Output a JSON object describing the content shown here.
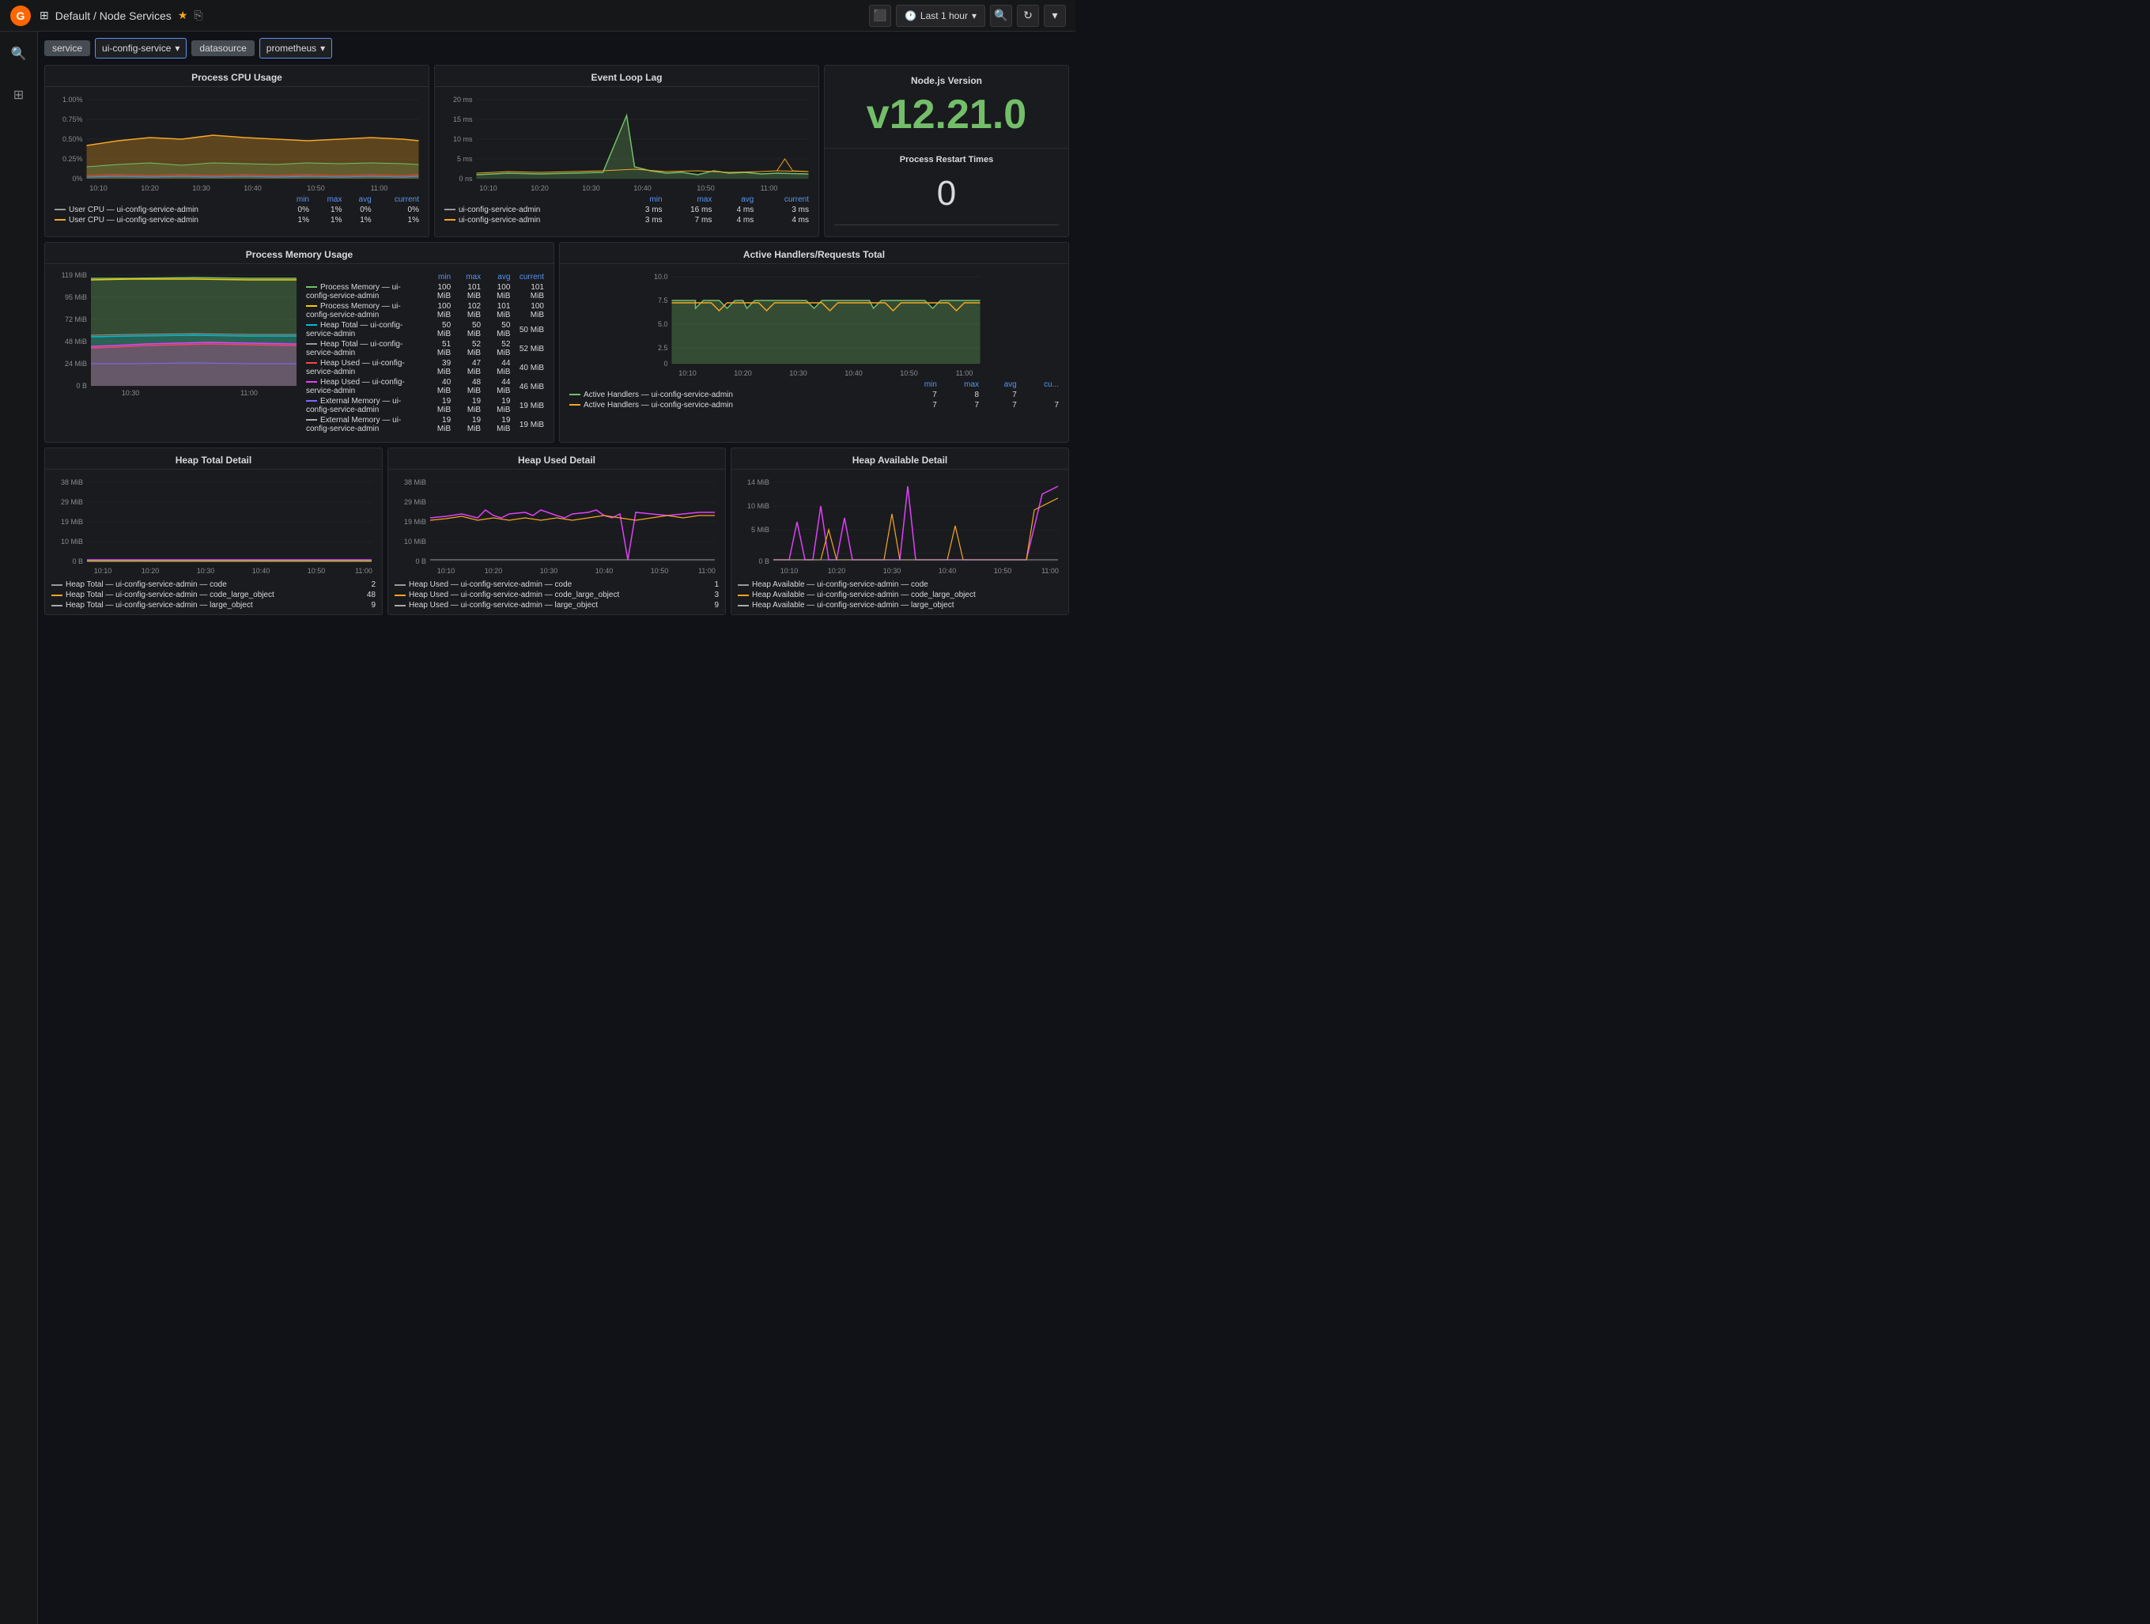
{
  "topbar": {
    "title": "Default / Node Services",
    "star_icon": "★",
    "share_icon": "⎘",
    "time_range": "Last 1 hour",
    "grid_icon": "⊞"
  },
  "filters": {
    "service_label": "service",
    "service_value": "ui-config-service",
    "datasource_label": "datasource",
    "datasource_value": "prometheus"
  },
  "panels": {
    "cpu_usage": {
      "title": "Process CPU Usage",
      "y_labels": [
        "1.00%",
        "0.75%",
        "0.50%",
        "0.25%",
        "0%"
      ],
      "x_labels": [
        "10:10",
        "10:20",
        "10:30",
        "10:40",
        "10:50",
        "11:00"
      ],
      "legend": {
        "headers": [
          "min",
          "max",
          "avg",
          "current"
        ],
        "rows": [
          {
            "color": "#999",
            "label": "User CPU — ui-config-service-admin",
            "min": "0%",
            "max": "1%",
            "avg": "0%",
            "current": "0%"
          },
          {
            "color": "#f5a623",
            "label": "User CPU — ui-config-service-admin",
            "min": "1%",
            "max": "1%",
            "avg": "1%",
            "current": "1%"
          }
        ]
      }
    },
    "event_loop": {
      "title": "Event Loop Lag",
      "y_labels": [
        "20 ms",
        "15 ms",
        "10 ms",
        "5 ms",
        "0 ns"
      ],
      "x_labels": [
        "10:10",
        "10:20",
        "10:30",
        "10:40",
        "10:50",
        "11:00"
      ],
      "legend": {
        "headers": [
          "min",
          "max",
          "avg",
          "current"
        ],
        "rows": [
          {
            "color": "#999",
            "label": "ui-config-service-admin",
            "min": "3 ms",
            "max": "16 ms",
            "avg": "4 ms",
            "current": "3 ms"
          },
          {
            "color": "#f5a623",
            "label": "ui-config-service-admin",
            "min": "3 ms",
            "max": "7 ms",
            "avg": "4 ms",
            "current": "4 ms"
          }
        ]
      }
    },
    "nodejs": {
      "title": "Node.js Version",
      "version": "v12.21.0"
    },
    "restart": {
      "title": "Process Restart Times",
      "value": "0"
    },
    "memory": {
      "title": "Process Memory Usage",
      "y_labels": [
        "119 MiB",
        "95 MiB",
        "72 MiB",
        "48 MiB",
        "24 MiB",
        "0 B"
      ],
      "x_labels": [
        "10:30",
        "11:00"
      ],
      "legend": {
        "headers": [
          "min",
          "max",
          "avg",
          "current"
        ],
        "rows": [
          {
            "color": "#73bf69",
            "label": "Process Memory — ui-config-service-admin",
            "min": "100 MiB",
            "max": "101 MiB",
            "avg": "100 MiB",
            "current": "101 MiB"
          },
          {
            "color": "#f2cc0c",
            "label": "Process Memory — ui-config-service-admin",
            "min": "100 MiB",
            "max": "102 MiB",
            "avg": "101 MiB",
            "current": "100 MiB"
          },
          {
            "color": "#00bcd4",
            "label": "Heap Total — ui-config-service-admin",
            "min": "50 MiB",
            "max": "50 MiB",
            "avg": "50 MiB",
            "current": "50 MiB"
          },
          {
            "color": "#999",
            "label": "Heap Total — ui-config-service-admin",
            "min": "51 MiB",
            "max": "52 MiB",
            "avg": "52 MiB",
            "current": "52 MiB"
          },
          {
            "color": "#f44747",
            "label": "Heap Used — ui-config-service-admin",
            "min": "39 MiB",
            "max": "47 MiB",
            "avg": "44 MiB",
            "current": "40 MiB"
          },
          {
            "color": "#e040fb",
            "label": "Heap Used — ui-config-service-admin",
            "min": "40 MiB",
            "max": "48 MiB",
            "avg": "44 MiB",
            "current": "46 MiB"
          },
          {
            "color": "#7c6af7",
            "label": "External Memory — ui-config-service-admin",
            "min": "19 MiB",
            "max": "19 MiB",
            "avg": "19 MiB",
            "current": "19 MiB"
          },
          {
            "color": "#aaa",
            "label": "External Memory — ui-config-service-admin",
            "min": "19 MiB",
            "max": "19 MiB",
            "avg": "19 MiB",
            "current": "19 MiB"
          }
        ]
      }
    },
    "active_handlers": {
      "title": "Active Handlers/Requests Total",
      "y_labels": [
        "10.0",
        "7.5",
        "5.0",
        "2.5",
        "0"
      ],
      "x_labels": [
        "10:10",
        "10:20",
        "10:30",
        "10:40",
        "10:50",
        "11:00"
      ],
      "legend": {
        "headers": [
          "min",
          "max",
          "avg",
          "cu..."
        ],
        "rows": [
          {
            "color": "#73bf69",
            "label": "Active Handlers — ui-config-service-admin",
            "min": "7",
            "max": "8",
            "avg": "7",
            "current": ""
          },
          {
            "color": "#f5a623",
            "label": "Active Handlers — ui-config-service-admin",
            "min": "7",
            "max": "7",
            "avg": "7",
            "current": "7"
          }
        ]
      }
    },
    "heap_total": {
      "title": "Heap Total Detail",
      "y_labels": [
        "38 MiB",
        "29 MiB",
        "19 MiB",
        "10 MiB",
        "0 B"
      ],
      "x_labels": [
        "10:10",
        "10:20",
        "10:30",
        "10:40",
        "10:50",
        "11:00"
      ],
      "legend": {
        "rows": [
          {
            "color": "#999",
            "label": "Heap Total — ui-config-service-admin — code",
            "value": "2"
          },
          {
            "color": "#f5a623",
            "label": "Heap Total — ui-config-service-admin — code_large_object",
            "value": "48"
          },
          {
            "color": "#aaa",
            "label": "Heap Total — ui-config-service-admin — large_object",
            "value": "9"
          }
        ]
      }
    },
    "heap_used": {
      "title": "Heap Used Detail",
      "y_labels": [
        "38 MiB",
        "29 MiB",
        "19 MiB",
        "10 MiB",
        "0 B"
      ],
      "x_labels": [
        "10:10",
        "10:20",
        "10:30",
        "10:40",
        "10:50",
        "11:00"
      ],
      "legend": {
        "rows": [
          {
            "color": "#999",
            "label": "Heap Used — ui-config-service-admin — code",
            "value": "1"
          },
          {
            "color": "#f5a623",
            "label": "Heap Used — ui-config-service-admin — code_large_object",
            "value": "3"
          },
          {
            "color": "#aaa",
            "label": "Heap Used — ui-config-service-admin — large_object",
            "value": "9"
          }
        ]
      }
    },
    "heap_available": {
      "title": "Heap Available Detail",
      "y_labels": [
        "14 MiB",
        "10 MiB",
        "5 MiB",
        "0 B"
      ],
      "x_labels": [
        "10:10",
        "10:20",
        "10:30",
        "10:40",
        "10:50",
        "11:00"
      ],
      "legend": {
        "rows": [
          {
            "color": "#999",
            "label": "Heap Available — ui-config-service-admin — code",
            "value": ""
          },
          {
            "color": "#f5a623",
            "label": "Heap Available — ui-config-service-admin — code_large_object",
            "value": ""
          },
          {
            "color": "#aaa",
            "label": "Heap Available — ui-config-service-admin — large_object",
            "value": ""
          }
        ]
      }
    }
  }
}
